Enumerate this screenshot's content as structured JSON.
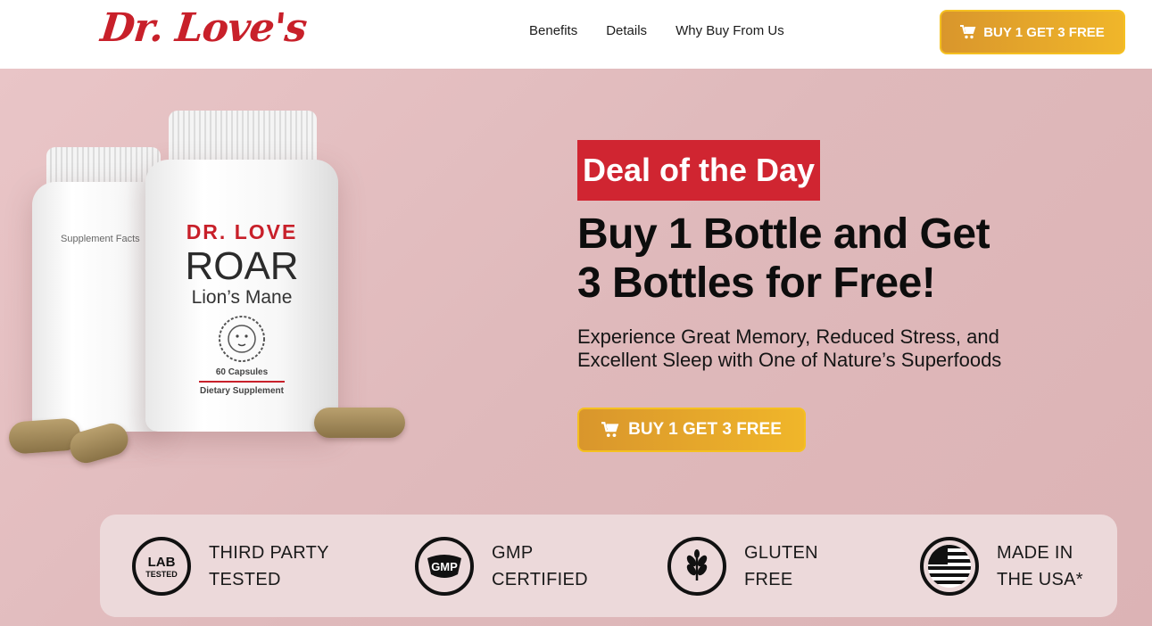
{
  "header": {
    "logo": "Dr. Love's",
    "nav": [
      "Benefits",
      "Details",
      "Why Buy From Us"
    ],
    "cta": "BUY 1 GET 3 FREE"
  },
  "hero": {
    "badge": "Deal of the Day",
    "headline_1": "Buy 1 Bottle and Get",
    "headline_2": "3 Bottles for Free!",
    "sub_1": "Experience Great Memory, Reduced Stress, and",
    "sub_2": "Excellent Sleep with One of Nature’s Superfoods",
    "cta": "BUY 1 GET 3 FREE"
  },
  "product": {
    "brand": "DR. LOVE",
    "name": "ROAR",
    "variant": "Lion’s Mane",
    "capsules": "60 Capsules",
    "type": "Dietary Supplement",
    "back_label": "Supplement Facts"
  },
  "trust": [
    {
      "line1": "THIRD PARTY",
      "line2": "TESTED",
      "icon": "lab-tested-icon",
      "icon_text": "LAB"
    },
    {
      "line1": "GMP",
      "line2": "CERTIFIED",
      "icon": "gmp-icon",
      "icon_text": "GMP"
    },
    {
      "line1": "GLUTEN",
      "line2": "FREE",
      "icon": "wheat-icon"
    },
    {
      "line1": "MADE IN",
      "line2": "THE USA*",
      "icon": "us-flag-icon"
    }
  ],
  "colors": {
    "brand_red": "#c8202a",
    "cta_gold": "#f0b62a",
    "hero_bg": "#e2bcbe"
  }
}
